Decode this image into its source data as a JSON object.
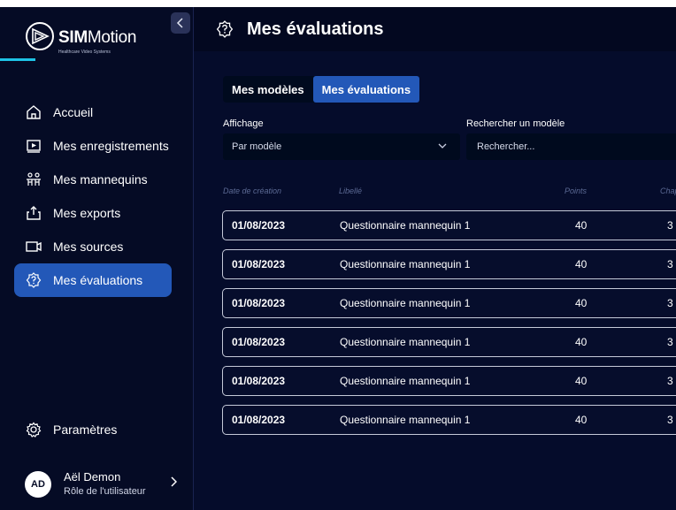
{
  "brand": {
    "name_bold": "SIM",
    "name_regular": "Motion",
    "tagline": "Healthcare Video Systems",
    "accent": "#1ec3e6"
  },
  "sidebar": {
    "items": [
      {
        "label": "Accueil",
        "icon": "home-icon"
      },
      {
        "label": "Mes enregistrements",
        "icon": "video-play-icon"
      },
      {
        "label": "Mes mannequins",
        "icon": "mannequins-icon"
      },
      {
        "label": "Mes exports",
        "icon": "export-icon"
      },
      {
        "label": "Mes sources",
        "icon": "camera-icon"
      },
      {
        "label": "Mes évaluations",
        "icon": "question-badge-icon",
        "active": true
      }
    ],
    "settings_label": "Paramètres",
    "user": {
      "initials": "AD",
      "name": "Aël Demon",
      "role": "Rôle de l'utilisateur"
    }
  },
  "header": {
    "title": "Mes évaluations"
  },
  "tabs": [
    {
      "label": "Mes modèles",
      "active": false
    },
    {
      "label": "Mes évaluations",
      "active": true
    }
  ],
  "filters": {
    "display_label": "Affichage",
    "display_value": "Par modèle",
    "search_label": "Rechercher un modèle",
    "search_placeholder": "Rechercher..."
  },
  "table": {
    "columns": [
      "Date de création",
      "Libellé",
      "Points",
      "Chap"
    ],
    "rows": [
      {
        "date": "01/08/2023",
        "label": "Questionnaire mannequin 1",
        "points": "40",
        "chapters": "3"
      },
      {
        "date": "01/08/2023",
        "label": "Questionnaire mannequin 1",
        "points": "40",
        "chapters": "3"
      },
      {
        "date": "01/08/2023",
        "label": "Questionnaire mannequin 1",
        "points": "40",
        "chapters": "3"
      },
      {
        "date": "01/08/2023",
        "label": "Questionnaire mannequin 1",
        "points": "40",
        "chapters": "3"
      },
      {
        "date": "01/08/2023",
        "label": "Questionnaire mannequin 1",
        "points": "40",
        "chapters": "3"
      },
      {
        "date": "01/08/2023",
        "label": "Questionnaire mannequin 1",
        "points": "40",
        "chapters": "3"
      }
    ]
  },
  "colors": {
    "background": "#050c2b",
    "sidebar": "#050b25",
    "active": "#2358b8",
    "field": "#000a1e"
  }
}
